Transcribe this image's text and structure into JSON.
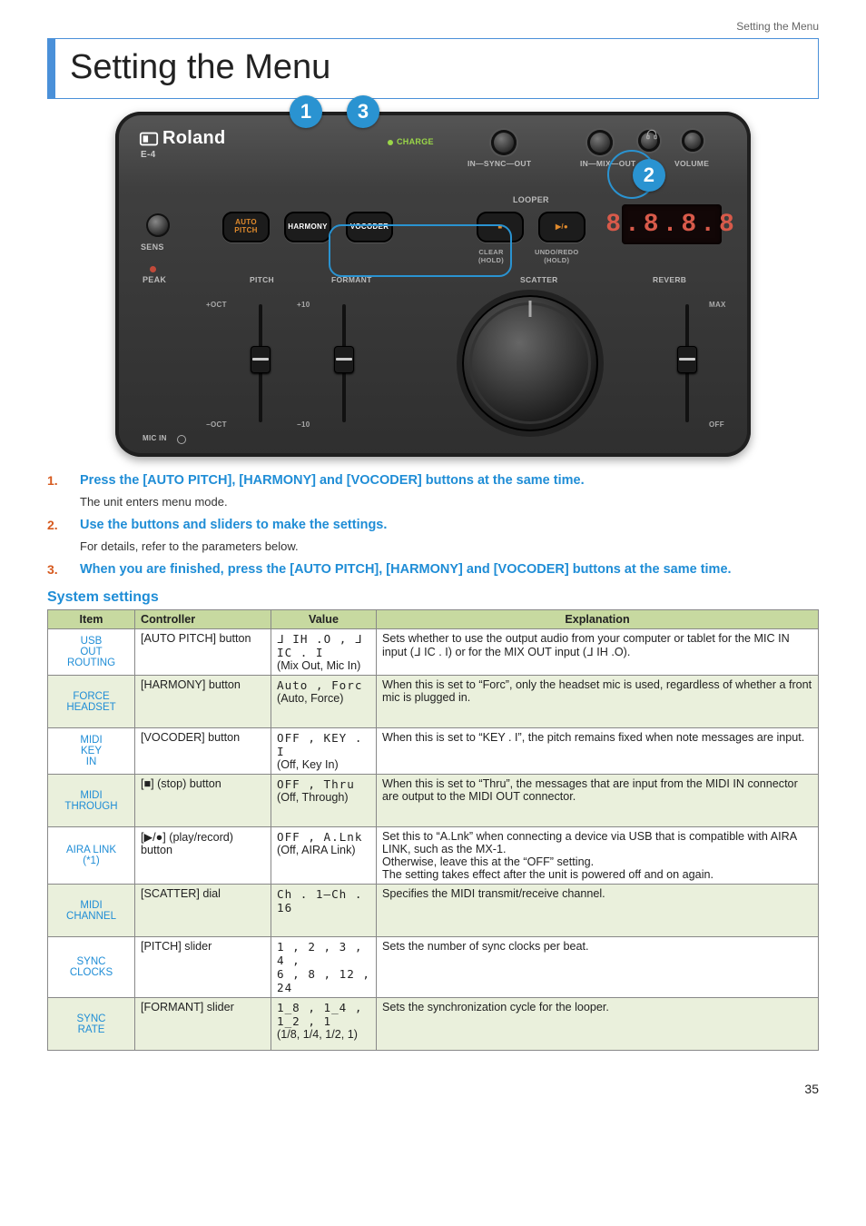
{
  "header": {
    "breadcrumb": "Setting the Menu",
    "title": "Setting the Menu"
  },
  "callouts": {
    "c1": "1",
    "c2": "2",
    "c3": "3"
  },
  "device": {
    "brand": "Roland",
    "model": "E-4",
    "charge": "CHARGE",
    "jacks": {
      "sync": "IN—SYNC—OUT",
      "mix": "IN—MIX—OUT",
      "vol": "VOLUME"
    },
    "sens": "SENS",
    "peak": "PEAK",
    "btn_autopitch": "AUTO\nPITCH",
    "btn_harmony": "HARMONY",
    "btn_vocoder": "VOCODER",
    "looper": "LOOPER",
    "stop_sym": "■",
    "play_sym": "▶/●",
    "clear": "CLEAR\n(HOLD)",
    "undo": "UNDO/REDO\n(HOLD)",
    "seg": "8.8.8.8",
    "labels": {
      "pitch": "PITCH",
      "formant": "FORMANT",
      "scatter": "SCATTER",
      "reverb": "REVERB"
    },
    "scale": {
      "p_hi": "+OCT",
      "p_lo": "−OCT",
      "f_hi": "+10",
      "f_lo": "−10",
      "r_hi": "MAX",
      "r_lo": "OFF"
    },
    "micin": "MIC IN"
  },
  "steps": {
    "s1": {
      "n": "1.",
      "head": "Press the [AUTO PITCH], [HARMONY] and [VOCODER] buttons at the same time.",
      "sub": "The unit enters menu mode."
    },
    "s2": {
      "n": "2.",
      "head": "Use the buttons and sliders to make the settings.",
      "sub": "For details, refer to the parameters below."
    },
    "s3": {
      "n": "3.",
      "head": "When you are finished, press the [AUTO PITCH], [HARMONY] and [VOCODER] buttons at the same time."
    }
  },
  "section": "System settings",
  "table": {
    "head": {
      "item": "Item",
      "controller": "Controller",
      "value": "Value",
      "expl": "Explanation"
    },
    "rows": [
      {
        "item": "USB OUT ROUTING",
        "ctrl": "[AUTO PITCH] button",
        "val_seg": "ᒧ IH .O , ᒧ IC . I",
        "val_txt": "(Mix Out, Mic In)",
        "expl": "Sets whether to use the output audio from your computer or tablet for the MIC IN input (ᒧ IC . I) or for the MIX OUT input (ᒧ IH .O)."
      },
      {
        "item": "FORCE HEADSET",
        "ctrl": "[HARMONY] button",
        "val_seg": "Auto , Forc",
        "val_txt": "(Auto, Force)",
        "expl": "When this is set to “Forc”, only the headset mic is used, regardless of whether a front mic is plugged in."
      },
      {
        "item": "MIDI KEY IN",
        "ctrl": "[VOCODER] button",
        "val_seg": "OFF , KEY . I",
        "val_txt": "(Off, Key In)",
        "expl": "When this is set to “KEY . I”, the pitch remains fixed when note messages are input."
      },
      {
        "item": "MIDI THROUGH",
        "ctrl": "[■] (stop) button",
        "val_seg": "OFF , Thru",
        "val_txt": "(Off, Through)",
        "expl": "When this is set to “Thru”, the messages that are input from the MIDI IN connector are output to the MIDI OUT connector."
      },
      {
        "item": "AIRA LINK (*1)",
        "ctrl": "[▶/●] (play/record) button",
        "val_seg": "OFF , A.Lnk",
        "val_txt": "(Off, AIRA Link)",
        "expl": "Set this to “A.Lnk” when connecting a device via USB that is compatible with AIRA LINK, such as the MX-1.\nOtherwise, leave this at the “OFF” setting.\nThe setting takes effect after the unit is powered off and on again."
      },
      {
        "item": "MIDI CHANNEL",
        "ctrl": "[SCATTER] dial",
        "val_seg": "Ch . 1–Ch . 16",
        "val_txt": "",
        "expl": "Specifies the MIDI transmit/receive channel."
      },
      {
        "item": "SYNC CLOCKS",
        "ctrl": "[PITCH] slider",
        "val_seg": "1 , 2 , 3 , 4 ,\n6 , 8 , 12 , 24",
        "val_txt": "",
        "expl": "Sets the number of sync clocks per beat."
      },
      {
        "item": "SYNC RATE",
        "ctrl": "[FORMANT] slider",
        "val_seg": "1_8 , 1_4 ,\n1_2 , 1",
        "val_txt": "(1/8, 1/4, 1/2, 1)",
        "expl": "Sets the synchronization cycle for the looper."
      }
    ]
  },
  "page_number": "35"
}
